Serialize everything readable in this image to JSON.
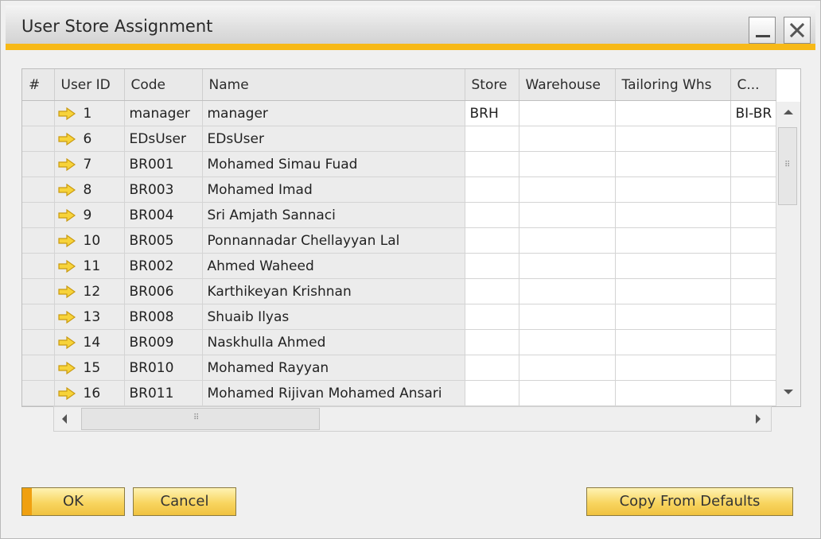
{
  "window": {
    "title": "User Store Assignment",
    "accent_color": "#f7b918"
  },
  "controls": {
    "minimize_icon": "minimize-icon",
    "close_icon": "close-x-icon"
  },
  "grid": {
    "columns": [
      "#",
      "User ID",
      "Code",
      "Name",
      "Store",
      "Warehouse",
      "Tailoring Whs",
      "C..."
    ],
    "row_icon": "yellow-right-arrow-icon",
    "rows": [
      {
        "user_id": "1",
        "code": "manager",
        "name": "manager",
        "store": "BRH",
        "warehouse": "",
        "tailoring": "",
        "c": "BI-BR"
      },
      {
        "user_id": "6",
        "code": "EDsUser",
        "name": "EDsUser",
        "store": "",
        "warehouse": "",
        "tailoring": "",
        "c": ""
      },
      {
        "user_id": "7",
        "code": "BR001",
        "name": "Mohamed Simau Fuad",
        "store": "",
        "warehouse": "",
        "tailoring": "",
        "c": ""
      },
      {
        "user_id": "8",
        "code": "BR003",
        "name": "Mohamed Imad",
        "store": "",
        "warehouse": "",
        "tailoring": "",
        "c": ""
      },
      {
        "user_id": "9",
        "code": "BR004",
        "name": "Sri Amjath  Sannaci",
        "store": "",
        "warehouse": "",
        "tailoring": "",
        "c": ""
      },
      {
        "user_id": "10",
        "code": "BR005",
        "name": "Ponnannadar Chellayyan Lal",
        "store": "",
        "warehouse": "",
        "tailoring": "",
        "c": ""
      },
      {
        "user_id": "11",
        "code": "BR002",
        "name": "Ahmed Waheed",
        "store": "",
        "warehouse": "",
        "tailoring": "",
        "c": ""
      },
      {
        "user_id": "12",
        "code": "BR006",
        "name": "Karthikeyan Krishnan",
        "store": "",
        "warehouse": "",
        "tailoring": "",
        "c": ""
      },
      {
        "user_id": "13",
        "code": "BR008",
        "name": "Shuaib Ilyas",
        "store": "",
        "warehouse": "",
        "tailoring": "",
        "c": ""
      },
      {
        "user_id": "14",
        "code": "BR009",
        "name": "Naskhulla Ahmed",
        "store": "",
        "warehouse": "",
        "tailoring": "",
        "c": ""
      },
      {
        "user_id": "15",
        "code": "BR010",
        "name": "Mohamed Rayyan",
        "store": "",
        "warehouse": "",
        "tailoring": "",
        "c": ""
      },
      {
        "user_id": "16",
        "code": "BR011",
        "name": "Mohamed Rijivan Mohamed Ansari",
        "store": "",
        "warehouse": "",
        "tailoring": "",
        "c": ""
      }
    ]
  },
  "buttons": {
    "ok": "OK",
    "cancel": "Cancel",
    "copy_defaults": "Copy From Defaults"
  }
}
